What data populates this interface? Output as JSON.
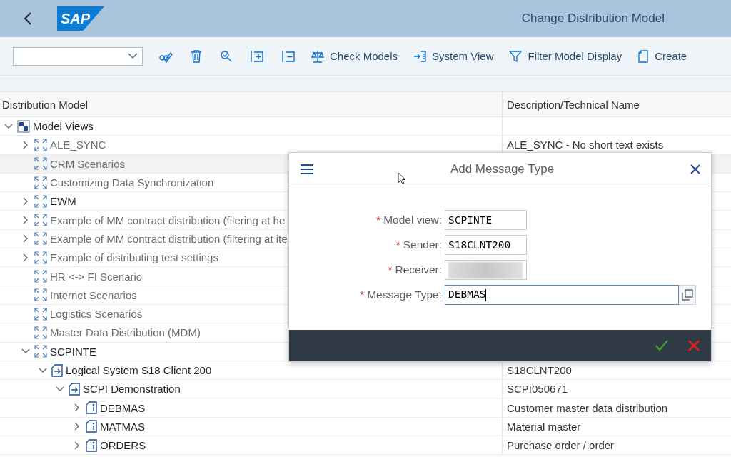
{
  "header": {
    "logo": "SAP",
    "title": "Change Distribution Model"
  },
  "toolbar": {
    "buttons": [
      {
        "label": "Check Models"
      },
      {
        "label": "System View"
      },
      {
        "label": "Filter Model Display"
      },
      {
        "label": "Create"
      }
    ]
  },
  "table": {
    "columns": [
      "Distribution Model",
      "Description/Technical Name"
    ],
    "tree": [
      {
        "label": "Model Views",
        "kind": "folder",
        "expanded": true,
        "dimmed": false,
        "selected": false,
        "children": [
          {
            "label": "ALE_SYNC",
            "kind": "view",
            "expanded": false,
            "dimmed": true,
            "selected": false,
            "description": "ALE_SYNC - No short text exists"
          },
          {
            "label": "CRM Scenarios",
            "kind": "view",
            "dimmed": true,
            "selected": true
          },
          {
            "label": "Customizing Data Synchronization",
            "kind": "view",
            "dimmed": true,
            "selected": false
          },
          {
            "label": "EWM",
            "kind": "view",
            "expanded": false,
            "dimmed": false,
            "selected": false
          },
          {
            "label": "Example of MM contract distribution (filering at he",
            "kind": "view",
            "expanded": false,
            "dimmed": true,
            "selected": false
          },
          {
            "label": "Example of MM contract distribution (filtering at ite",
            "kind": "view",
            "expanded": false,
            "dimmed": true,
            "selected": false
          },
          {
            "label": "Example of distributing test settings",
            "kind": "view",
            "expanded": false,
            "dimmed": true,
            "selected": false
          },
          {
            "label": "HR <-> FI Scenario",
            "kind": "view",
            "dimmed": true,
            "selected": false
          },
          {
            "label": "Internet Scenarios",
            "kind": "view",
            "dimmed": true,
            "selected": false
          },
          {
            "label": "Logistics Scenarios",
            "kind": "view",
            "dimmed": true,
            "selected": false
          },
          {
            "label": "Master Data Distribution (MDM)",
            "kind": "view",
            "dimmed": true,
            "selected": false
          },
          {
            "label": "SCPINTE",
            "kind": "view",
            "expanded": true,
            "dimmed": false,
            "selected": false,
            "children": [
              {
                "label": "Logical System S18 Client 200",
                "kind": "system",
                "expanded": true,
                "dimmed": false,
                "selected": false,
                "description": "S18CLNT200",
                "children": [
                  {
                    "label": "SCPI Demonstration",
                    "kind": "system",
                    "expanded": true,
                    "dimmed": false,
                    "selected": false,
                    "description": "SCPI050671",
                    "children": [
                      {
                        "label": "DEBMAS",
                        "kind": "message",
                        "expanded": false,
                        "dimmed": false,
                        "selected": false,
                        "description": "Customer master data distribution"
                      },
                      {
                        "label": "MATMAS",
                        "kind": "message",
                        "expanded": false,
                        "dimmed": false,
                        "selected": false,
                        "description": "Material master"
                      },
                      {
                        "label": "ORDERS",
                        "kind": "message",
                        "expanded": false,
                        "dimmed": false,
                        "selected": false,
                        "description": "Purchase order / order"
                      }
                    ]
                  }
                ]
              }
            ]
          }
        ]
      }
    ]
  },
  "dialog": {
    "title": "Add Message Type",
    "fields": [
      {
        "label": "Model view:",
        "required_mark": "*",
        "value": "SCPINTE",
        "focused": false,
        "wide": false
      },
      {
        "label": "Sender:",
        "required_mark": "*",
        "value": "S18CLNT200",
        "focused": false,
        "wide": false
      },
      {
        "label": "Receiver:",
        "required_mark": "*",
        "blurred": true,
        "focused": false,
        "wide": false
      },
      {
        "label": "Message Type:",
        "required_mark": "*",
        "value": "DEBMAS",
        "focused": true,
        "wide": true
      }
    ]
  }
}
